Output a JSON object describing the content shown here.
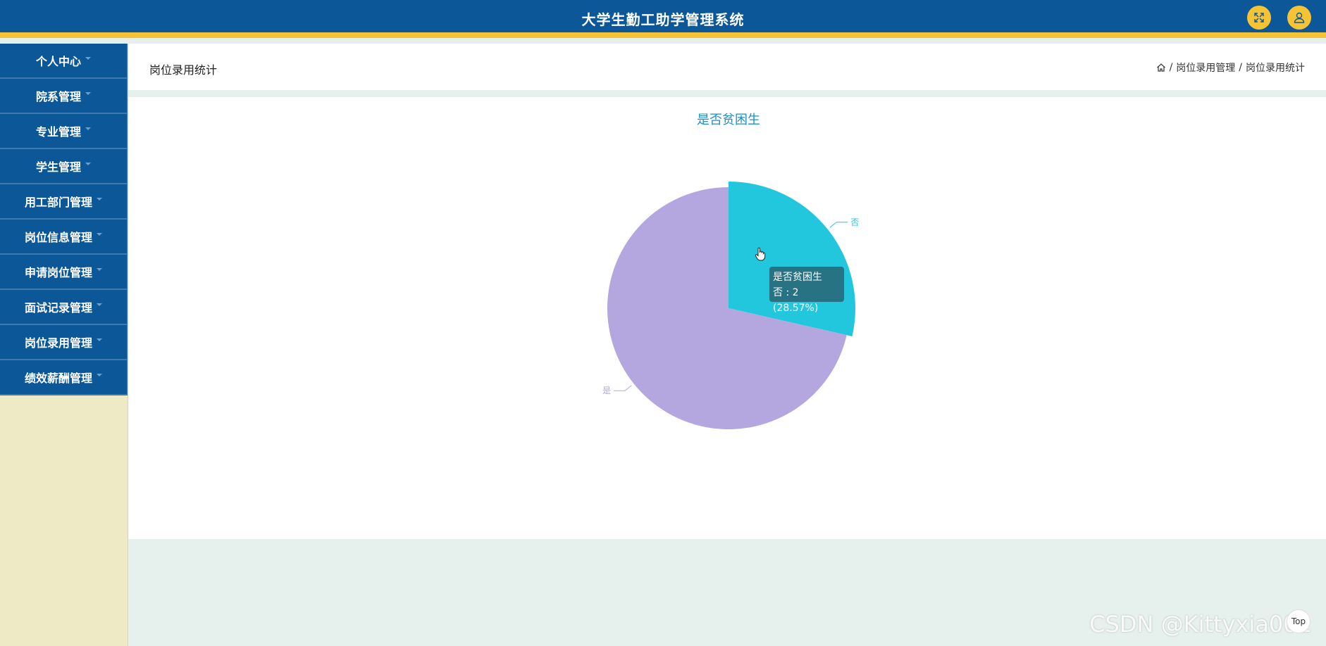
{
  "header": {
    "title": "大学生勤工助学管理系统",
    "fullscreen_icon": "expand-icon",
    "user_icon": "user-icon"
  },
  "sidebar": {
    "items": [
      {
        "label": "个人中心"
      },
      {
        "label": "院系管理"
      },
      {
        "label": "专业管理"
      },
      {
        "label": "学生管理"
      },
      {
        "label": "用工部门管理"
      },
      {
        "label": "岗位信息管理"
      },
      {
        "label": "申请岗位管理"
      },
      {
        "label": "面试记录管理"
      },
      {
        "label": "岗位录用管理"
      },
      {
        "label": "绩效薪酬管理"
      }
    ]
  },
  "page": {
    "title": "岗位录用统计",
    "breadcrumb": [
      "岗位录用管理",
      "岗位录用统计"
    ],
    "breadcrumb_sep": "/"
  },
  "chart_data": {
    "type": "pie",
    "title": "是否贫困生",
    "slices": [
      {
        "name": "否",
        "value": 2,
        "color": "#22c7dd"
      },
      {
        "name": "是",
        "value": 5,
        "color": "#b4a7df"
      }
    ]
  },
  "tooltip": {
    "title": "是否贫困生",
    "text": "否 : 2 (28.57%)"
  },
  "watermark": "CSDN @Kittyxia001",
  "scroll_top_label": "Top"
}
